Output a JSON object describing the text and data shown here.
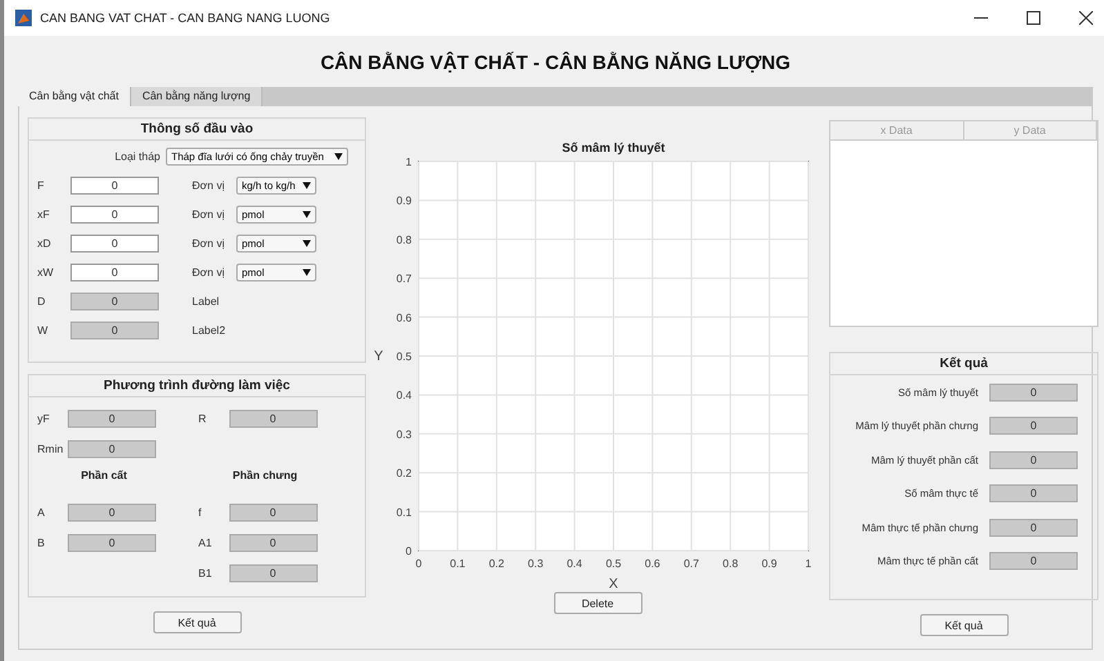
{
  "window": {
    "title": "CAN BANG VAT CHAT - CAN BANG NANG LUONG"
  },
  "heading": "CÂN BẰNG VẬT CHẤT - CÂN BẰNG NĂNG LƯỢNG",
  "tabs": [
    {
      "label": "Cân bằng vật chất",
      "selected": true
    },
    {
      "label": "Cân bằng năng lượng",
      "selected": false
    }
  ],
  "inputs": {
    "title": "Thông số đầu vào",
    "tower_label": "Loại tháp",
    "tower_value": "Tháp đĩa lưới có ống chảy truyền",
    "fields": [
      {
        "label": "F",
        "value": "0",
        "editable": true,
        "unit_label": "Đơn vị",
        "unit": "kg/h to kg/h"
      },
      {
        "label": "xF",
        "value": "0",
        "editable": true,
        "unit_label": "Đơn vị",
        "unit": "pmol"
      },
      {
        "label": "xD",
        "value": "0",
        "editable": true,
        "unit_label": "Đơn vị",
        "unit": "pmol"
      },
      {
        "label": "xW",
        "value": "0",
        "editable": true,
        "unit_label": "Đơn vị",
        "unit": "pmol"
      },
      {
        "label": "D",
        "value": "0",
        "editable": false,
        "note": "Label"
      },
      {
        "label": "W",
        "value": "0",
        "editable": false,
        "note": "Label2"
      }
    ]
  },
  "working_line": {
    "title": "Phương trình đường làm việc",
    "columns": [
      {
        "fields": [
          {
            "label": "yF",
            "value": "0"
          },
          {
            "label": "Rmin",
            "value": "0"
          }
        ],
        "section": "Phần cất",
        "section_fields": [
          {
            "label": "A",
            "value": "0"
          },
          {
            "label": "B",
            "value": "0"
          }
        ]
      },
      {
        "fields": [
          {
            "label": "R",
            "value": "0"
          }
        ],
        "section": "Phần chưng",
        "section_fields": [
          {
            "label": "f",
            "value": "0"
          },
          {
            "label": "A1",
            "value": "0"
          },
          {
            "label": "B1",
            "value": "0"
          }
        ]
      }
    ]
  },
  "chart_data": {
    "type": "line",
    "title": "Số mâm lý thuyết",
    "xlabel": "X",
    "ylabel": "Y",
    "xlim": [
      0,
      1
    ],
    "ylim": [
      0,
      1
    ],
    "grid": true,
    "xticks": [
      0,
      0.1,
      0.2,
      0.3,
      0.4,
      0.5,
      0.6,
      0.7,
      0.8,
      0.9,
      1
    ],
    "yticks": [
      0,
      0.1,
      0.2,
      0.3,
      0.4,
      0.5,
      0.6,
      0.7,
      0.8,
      0.9,
      1
    ]
  },
  "table": {
    "columns": [
      "x Data",
      "y Data"
    ]
  },
  "results": {
    "title": "Kết quả",
    "fields": [
      {
        "label": "Số mâm lý thuyết",
        "value": "0"
      },
      {
        "label": "Mâm lý thuyết phần chưng",
        "value": "0"
      },
      {
        "label": "Mâm lý thuyết phần cất",
        "value": "0"
      },
      {
        "label": "Số mâm thực tế",
        "value": "0"
      },
      {
        "label": "Mâm thực tế phần chưng",
        "value": "0"
      },
      {
        "label": "Mâm thực tế phần cất",
        "value": "0"
      }
    ]
  },
  "buttons": {
    "left": "Kết quả",
    "center": "Delete",
    "right": "Kết quả"
  }
}
